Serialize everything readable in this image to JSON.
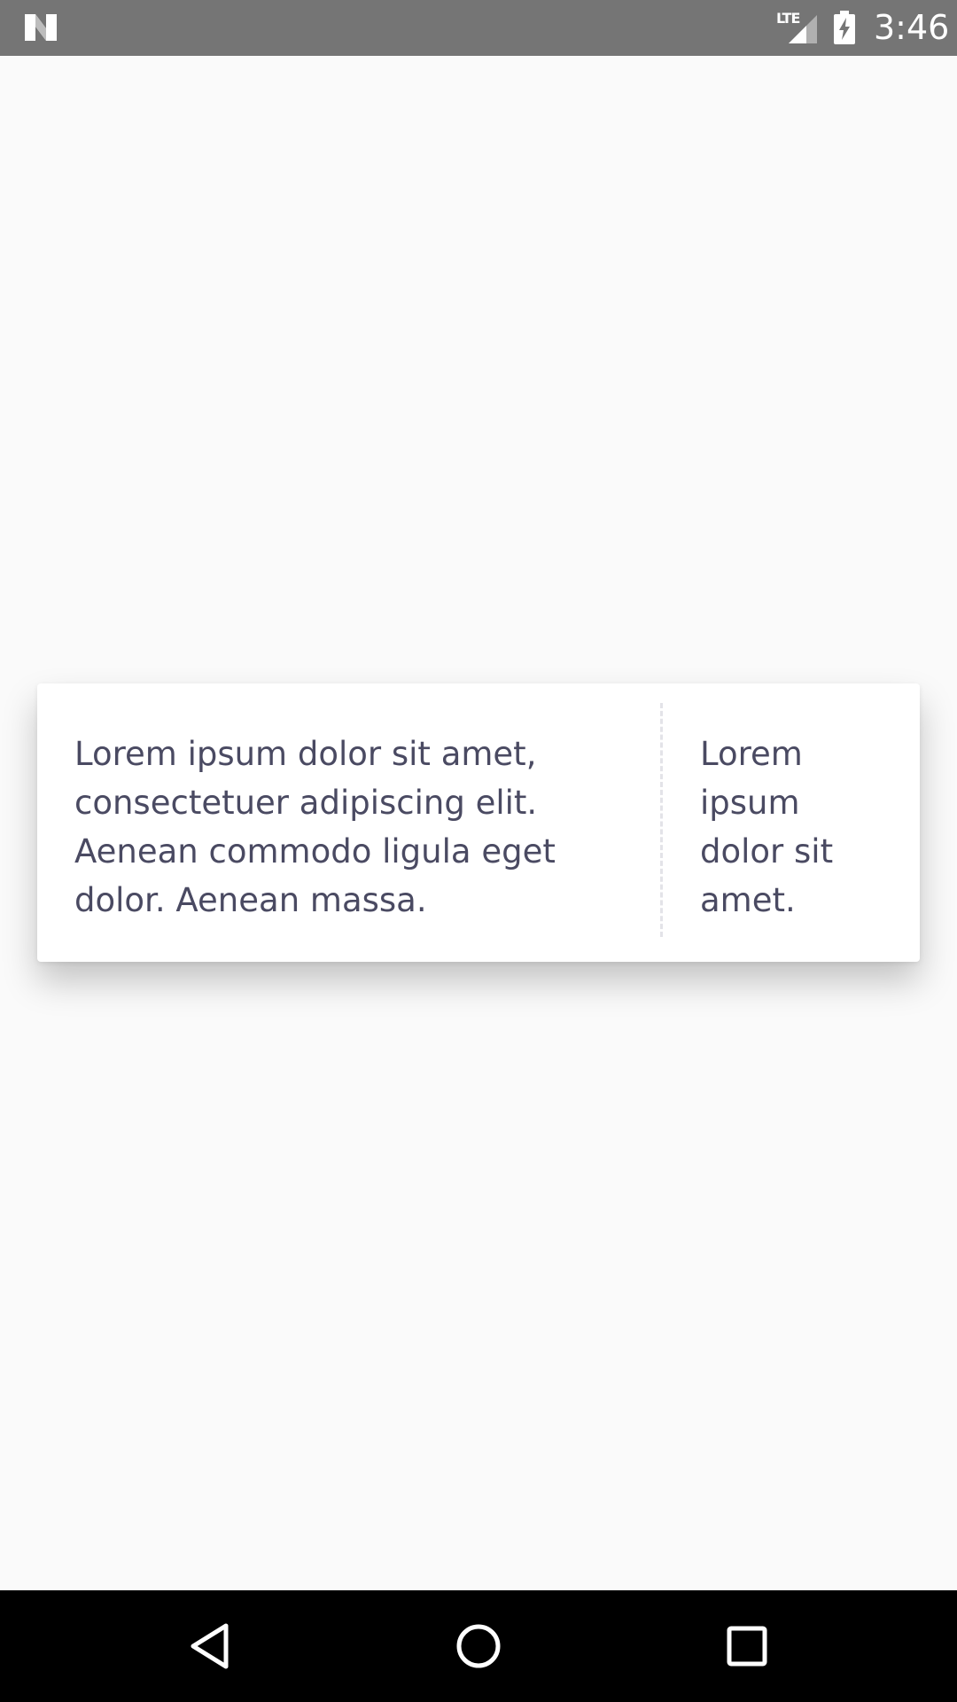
{
  "status_bar": {
    "network_label": "LTE",
    "time": "3:46",
    "icons": {
      "logo": "android-n-logo-icon",
      "signal": "cell-signal-icon",
      "battery": "battery-charging-icon"
    }
  },
  "card": {
    "main_text": "Lorem ipsum dolor sit amet, consectetuer adipiscing elit. Aenean commodo ligula eget dolor. Aenean massa.",
    "side_text": "Lorem ipsum dolor sit amet."
  },
  "nav_bar": {
    "icons": {
      "back": "back-triangle-icon",
      "home": "home-circle-icon",
      "recents": "recents-square-icon"
    }
  },
  "colors": {
    "status_bar": "#757575",
    "background": "#fafafa",
    "card": "#ffffff",
    "text": "#4a4a62",
    "divider": "#e3e3e8",
    "nav_bar": "#000000"
  }
}
